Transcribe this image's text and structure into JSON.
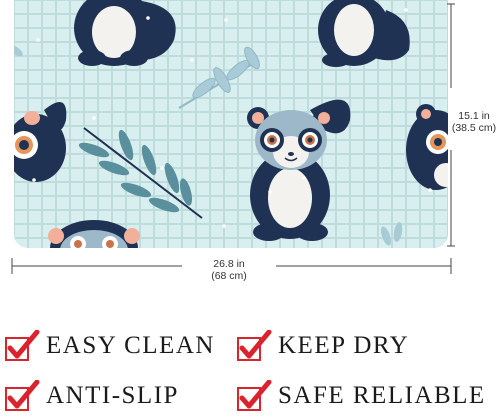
{
  "product": {
    "height_in": "15.1 in",
    "height_cm": "(38.5 cm)",
    "width_in": "26.8 in",
    "width_cm": "(68 cm)"
  },
  "features": [
    {
      "label": "EASY CLEAN"
    },
    {
      "label": "KEEP DRY"
    },
    {
      "label": "ANTI-SLIP"
    },
    {
      "label": "SAFE RELIABLE"
    }
  ],
  "colors": {
    "mat_bg": "#d7ecec",
    "animal_dark": "#1f3254",
    "leaf": "#9fc4d2",
    "check_red": "#d9232d"
  }
}
